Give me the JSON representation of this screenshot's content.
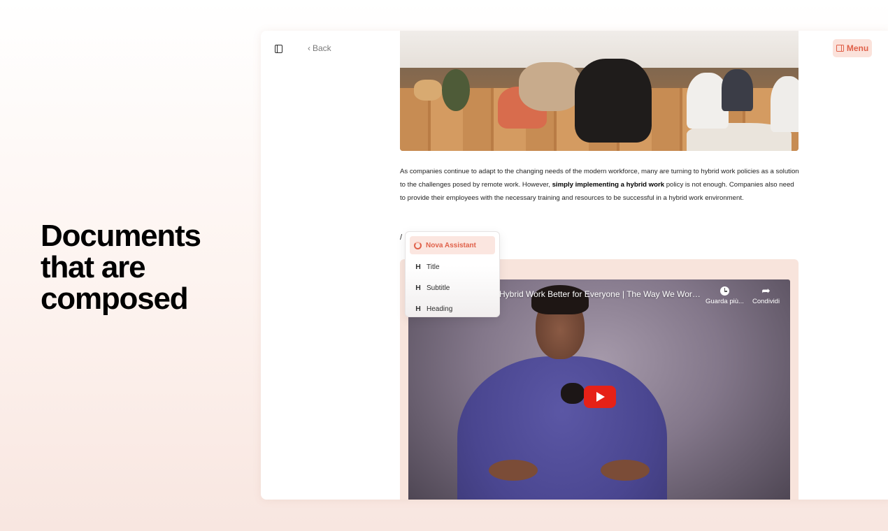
{
  "hero": {
    "headline": "Documents\nthat are\ncomposed"
  },
  "toolbar": {
    "sidebar_icon": "sidebar-toggle-icon",
    "back_label": "Back",
    "back_icon": "chevron-left-icon",
    "menu_label": "Menu",
    "menu_icon": "panel-right-icon"
  },
  "document": {
    "paragraph_intro": "As companies continue to adapt to the changing needs of the modern workforce, many are turning to hybrid work policies as a solution to the challenges posed by remote work. However, ",
    "paragraph_bold": "simply implementing a hybrid work",
    "paragraph_outro": " policy is not enough. Companies also need to provide their employees with the necessary training and resources to be successful in a hybrid work environment.",
    "slash_command": "/"
  },
  "slash_menu": {
    "items": [
      {
        "label": "Nova Assistant",
        "icon": "nova-assistant-icon",
        "active": true
      },
      {
        "label": "Title",
        "icon": "H"
      },
      {
        "label": "Subtitle",
        "icon": "H"
      },
      {
        "label": "Heading",
        "icon": "H"
      }
    ]
  },
  "video": {
    "title": "Hybrid Work Better for Everyone | The Way We Work...",
    "watch_later_label": "Guarda più...",
    "share_label": "Condividi",
    "play_icon": "play-icon",
    "colors": {
      "play_button": "#e62117"
    }
  },
  "colors": {
    "accent": "#e0614a",
    "accent_bg": "#fbe2db",
    "card_bg": "#f8e4dc"
  }
}
